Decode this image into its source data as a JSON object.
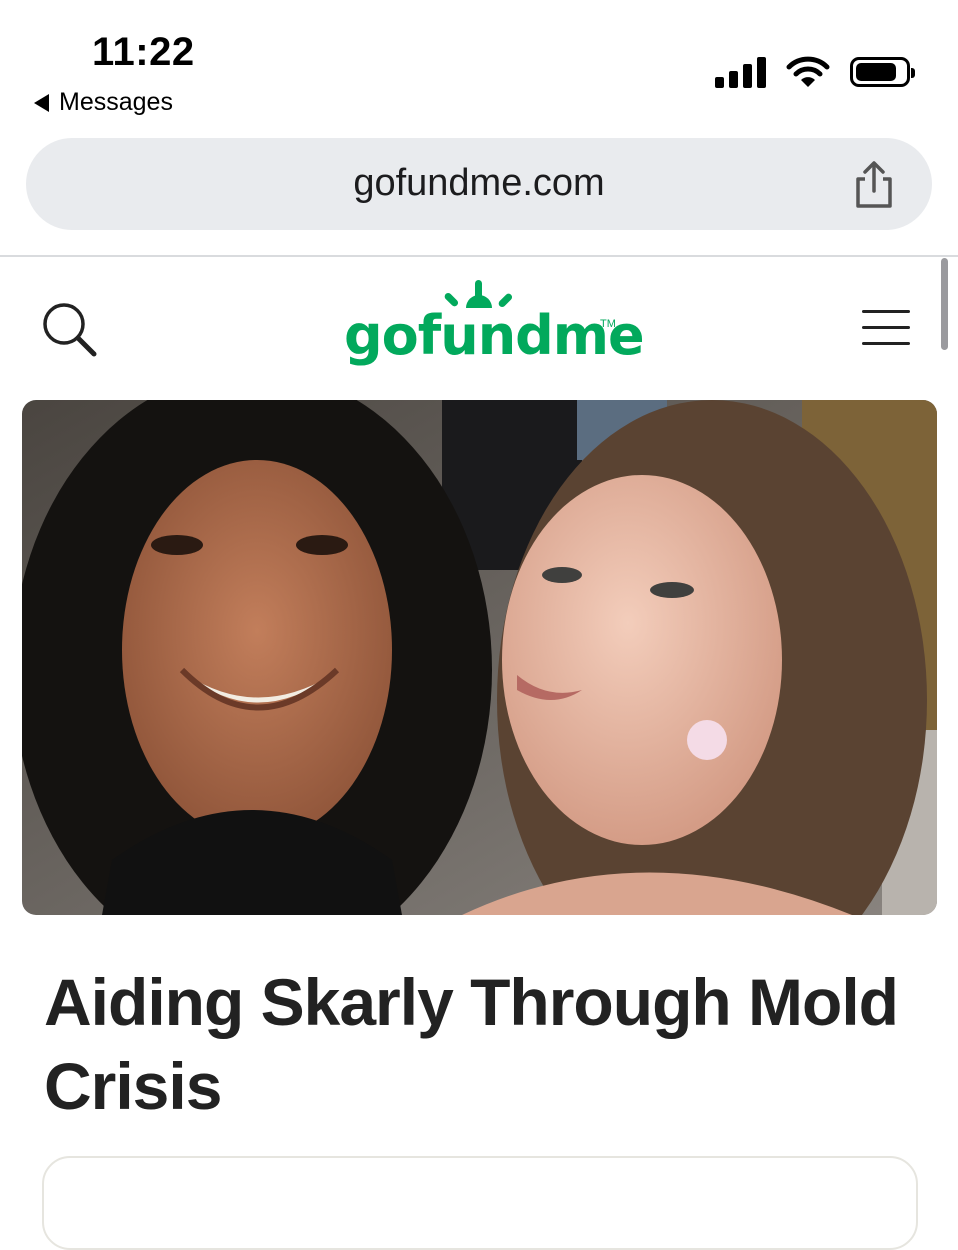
{
  "status_bar": {
    "time": "11:22",
    "back_label": "Messages"
  },
  "browser": {
    "url": "gofundme.com"
  },
  "site": {
    "logo_text": "gofundme",
    "logo_tm": "TM",
    "brand_color": "#02a95c"
  },
  "campaign": {
    "title": "Aiding Skarly Through Mold Crisis"
  }
}
